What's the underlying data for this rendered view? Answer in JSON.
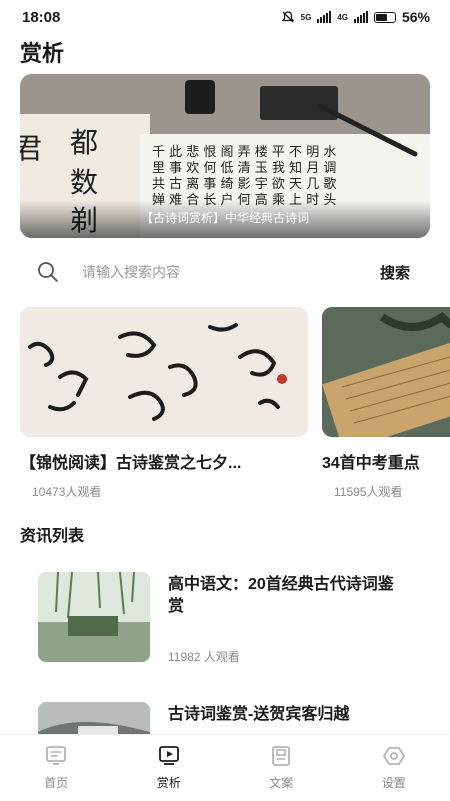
{
  "status_bar": {
    "time": "18:08",
    "net1": "5G",
    "net2": "4G",
    "battery": "56%"
  },
  "page_title": "赏析",
  "banner": {
    "caption": "【古诗词赏析】中华经典古诗词"
  },
  "search": {
    "placeholder": "请输入搜索内容",
    "button": "搜索"
  },
  "featured": [
    {
      "title": "【锦悦阅读】古诗鉴赏之七夕...",
      "views": "10473人观看"
    },
    {
      "title": "34首中考重点",
      "views": "11595人观看"
    }
  ],
  "news_section_title": "资讯列表",
  "news": [
    {
      "title": "高中语文：20首经典古代诗词鉴赏",
      "views": "11982 人观看"
    },
    {
      "title": "古诗词鉴赏-送贺宾客归越",
      "views": ""
    }
  ],
  "tabs": [
    {
      "label": "首页",
      "icon": "home-icon",
      "active": false
    },
    {
      "label": "赏析",
      "icon": "play-tv-icon",
      "active": true
    },
    {
      "label": "文案",
      "icon": "document-icon",
      "active": false
    },
    {
      "label": "设置",
      "icon": "settings-icon",
      "active": false
    }
  ]
}
